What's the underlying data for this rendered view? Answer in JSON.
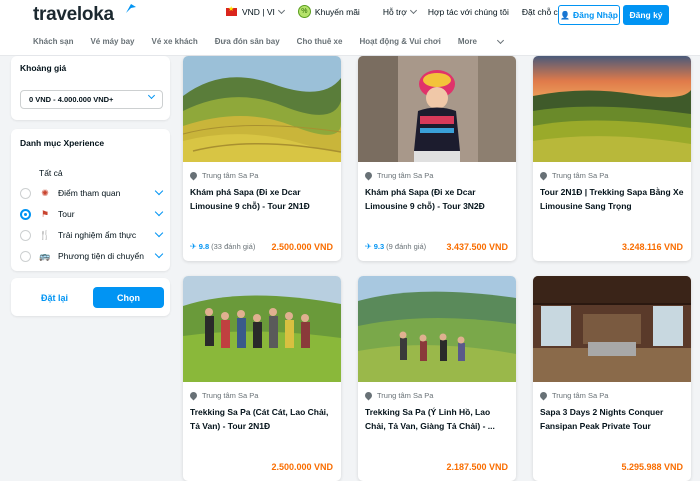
{
  "header": {
    "logo": "traveloka",
    "currency_lang": "VND | VI",
    "promo": "Khuyến mãi",
    "support": "Hỗ trợ",
    "partner": "Hợp tác với chúng tôi",
    "bookings": "Đặt chỗ của tôi",
    "login": "Đăng Nhập",
    "register": "Đăng ký"
  },
  "nav": [
    "Khách sạn",
    "Vé máy bay",
    "Vé xe khách",
    "Đưa đón sân bay",
    "Cho thuê xe",
    "Hoạt động & Vui chơi",
    "More"
  ],
  "filters": {
    "price_title": "Khoảng giá",
    "price_range": "0 VND - 4.000.000 VND+",
    "category_title": "Danh mục Xperience",
    "categories": [
      {
        "label": "Tất cả",
        "selected": false
      },
      {
        "label": "Điểm tham quan",
        "selected": false
      },
      {
        "label": "Tour",
        "selected": true
      },
      {
        "label": "Trải nghiệm ẩm thực",
        "selected": false
      },
      {
        "label": "Phương tiện di chuyển",
        "selected": false
      }
    ],
    "reset": "Đặt lại",
    "apply": "Chọn"
  },
  "cards": [
    {
      "location": "Trung tâm Sa Pa",
      "name": "Khám phá Sapa (Đi xe Dcar Limousine 9 chỗ) - Tour 2N1Đ",
      "score": "9.8",
      "count": "(33 đánh giá)",
      "price": "2.500.000 VND"
    },
    {
      "location": "Trung tâm Sa Pa",
      "name": "Khám phá Sapa (Đi xe Dcar Limousine 9 chỗ) - Tour 3N2Đ",
      "score": "9.3",
      "count": "(9 đánh giá)",
      "price": "3.437.500 VND"
    },
    {
      "location": "Trung tâm Sa Pa",
      "name": "Tour 2N1Đ | Trekking Sapa Bằng Xe Limousine Sang Trọng",
      "score": "",
      "count": "",
      "price": "3.248.116 VND"
    },
    {
      "location": "Trung tâm Sa Pa",
      "name": "Trekking Sa Pa (Cát Cát, Lao Chải, Tả Van) - Tour 2N1Đ",
      "score": "",
      "count": "",
      "price": "2.500.000 VND"
    },
    {
      "location": "Trung tâm Sa Pa",
      "name": "Trekking Sa Pa (Ý Linh Hồ, Lao Chải, Tả Van, Giàng Tả Chải) - ...",
      "score": "",
      "count": "",
      "price": "2.187.500 VND"
    },
    {
      "location": "Trung tâm Sa Pa",
      "name": "Sapa 3 Days 2 Nights Conquer Fansipan Peak Private Tour",
      "score": "",
      "count": "",
      "price": "5.295.988 VND"
    }
  ]
}
